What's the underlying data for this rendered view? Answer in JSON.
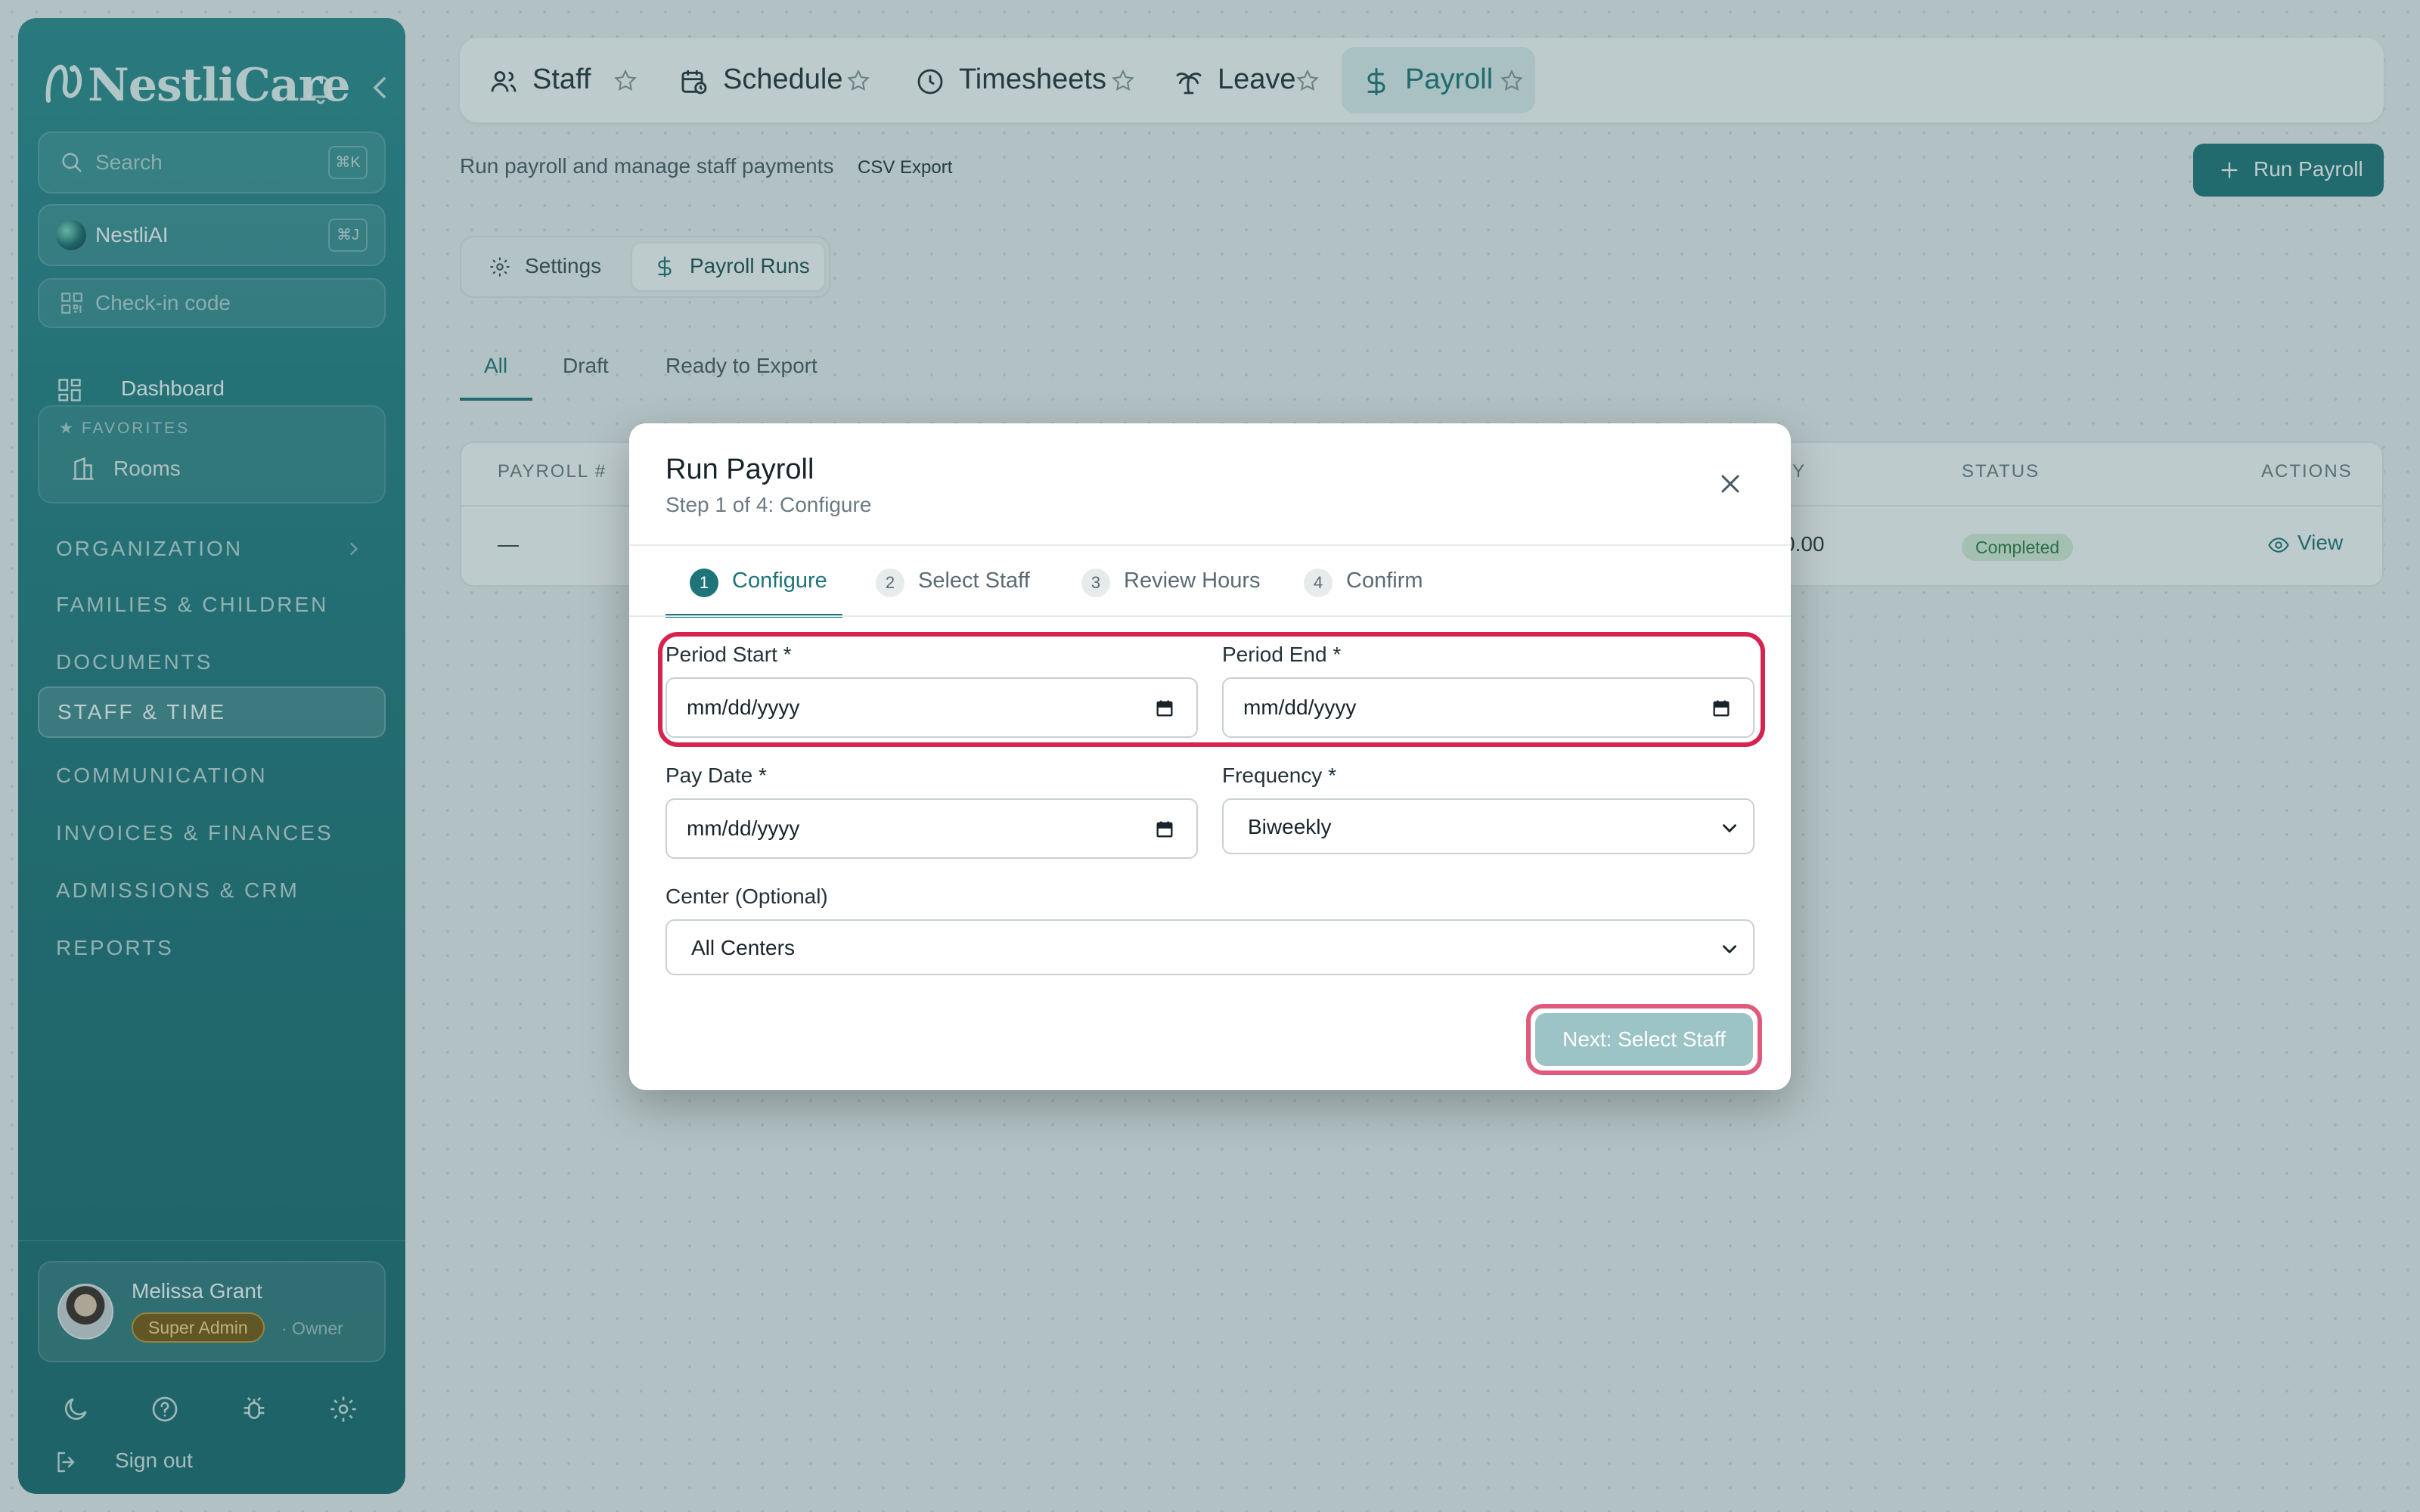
{
  "app": {
    "brand": "NestliCare",
    "colors": {
      "accent": "#1f7479",
      "highlight": "#d6244f",
      "sidebar": "#1f7479"
    }
  },
  "sidebar": {
    "search": {
      "placeholder": "Search",
      "shortcut": "⌘K"
    },
    "ai": {
      "label": "NestliAI",
      "shortcut": "⌘J"
    },
    "checkin": {
      "placeholder": "Check-in code"
    },
    "dashboard": "Dashboard",
    "favorites": {
      "heading": "FAVORITES",
      "items": [
        "Rooms"
      ]
    },
    "sections": [
      "ORGANIZATION",
      "FAMILIES & CHILDREN",
      "DOCUMENTS",
      "STAFF & TIME",
      "COMMUNICATION",
      "INVOICES & FINANCES",
      "ADMISSIONS & CRM",
      "REPORTS"
    ],
    "active_section": "STAFF & TIME",
    "user": {
      "name": "Melissa Grant",
      "role": "Super Admin",
      "sub": "· Owner"
    },
    "signout": "Sign out"
  },
  "topbar": {
    "tabs": [
      "Staff",
      "Schedule",
      "Timesheets",
      "Leave",
      "Payroll"
    ],
    "active_tab": "Payroll"
  },
  "page": {
    "subtitle": "Run payroll and manage staff payments",
    "csv_export": "CSV Export",
    "run_payroll": "Run Payroll",
    "segments": [
      "Settings",
      "Payroll Runs"
    ],
    "active_segment": "Payroll Runs",
    "filter_tabs": [
      "All",
      "Draft",
      "Ready to Export"
    ],
    "active_filter": "All",
    "table": {
      "headers": {
        "payroll": "PAYROLL #",
        "pay": "Y",
        "status": "STATUS",
        "actions": "ACTIONS"
      },
      "rows": [
        {
          "payroll": "—",
          "amount": "0.00",
          "status": "Completed",
          "action": "View"
        }
      ]
    }
  },
  "modal": {
    "title": "Run Payroll",
    "subtitle": "Step 1 of 4: Configure",
    "steps": [
      {
        "num": "1",
        "label": "Configure"
      },
      {
        "num": "2",
        "label": "Select Staff"
      },
      {
        "num": "3",
        "label": "Review Hours"
      },
      {
        "num": "4",
        "label": "Confirm"
      }
    ],
    "active_step": 1,
    "fields": {
      "period_start": {
        "label": "Period Start *",
        "value": "mm/dd/yyyy"
      },
      "period_end": {
        "label": "Period End *",
        "value": "mm/dd/yyyy"
      },
      "pay_date": {
        "label": "Pay Date *",
        "value": "mm/dd/yyyy"
      },
      "frequency": {
        "label": "Frequency *",
        "value": "Biweekly"
      },
      "center": {
        "label": "Center (Optional)",
        "value": "All Centers"
      }
    },
    "next_button": "Next: Select Staff"
  }
}
